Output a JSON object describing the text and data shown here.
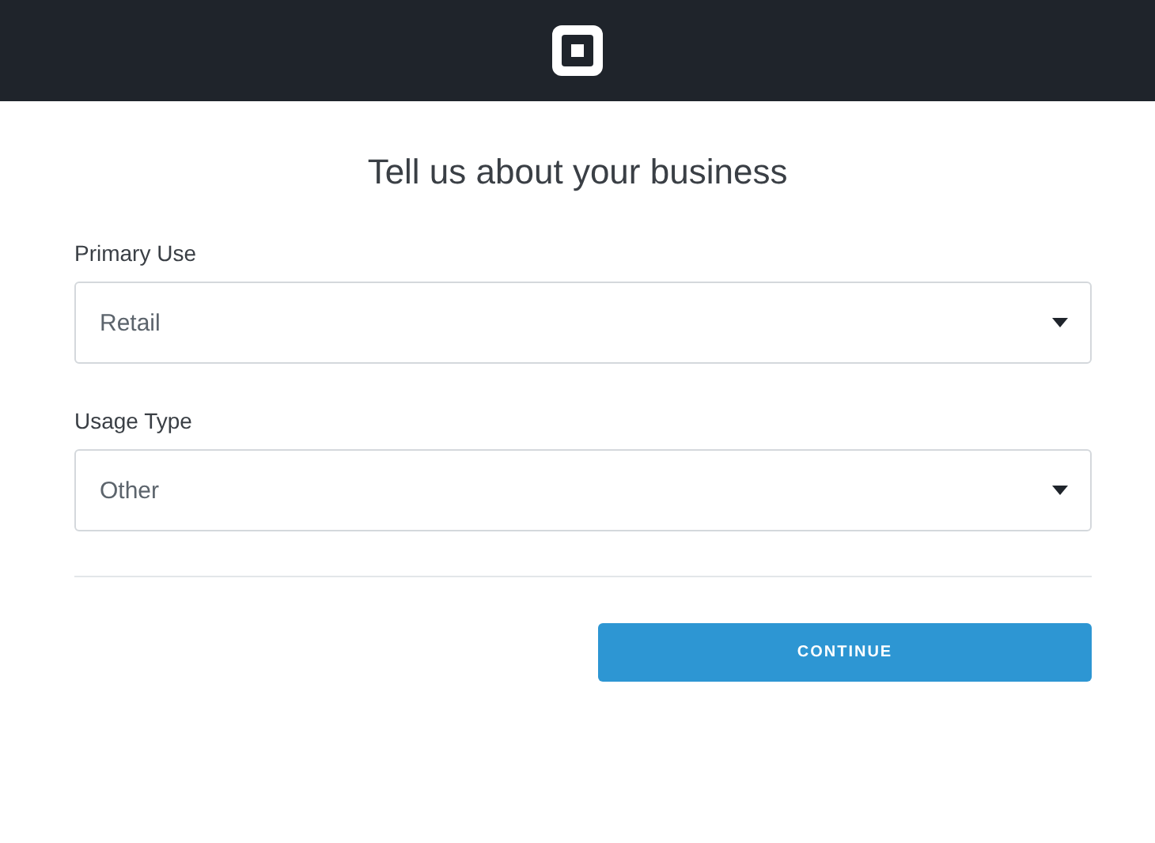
{
  "title": "Tell us about your business",
  "fields": [
    {
      "label": "Primary Use",
      "value": "Retail"
    },
    {
      "label": "Usage Type",
      "value": "Other"
    }
  ],
  "button": "CONTINUE"
}
